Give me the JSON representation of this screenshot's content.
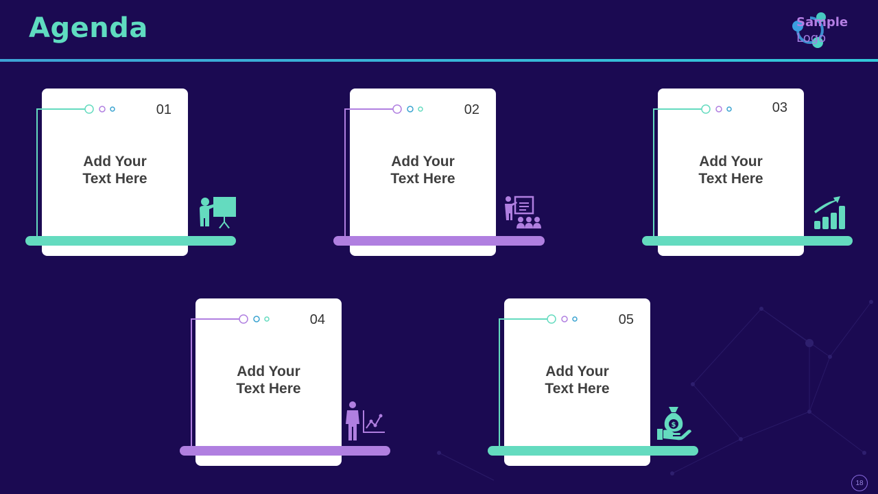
{
  "title": "Agenda",
  "logo": {
    "line1": "Sample",
    "line2": "Logo"
  },
  "page_number": "18",
  "colors": {
    "background": "#1b0a52",
    "teal": "#64dbbf",
    "purple": "#b07fe0",
    "divider": "#33b5d9"
  },
  "items": [
    {
      "number": "01",
      "line1": "Add Your",
      "line2": "Text Here",
      "accent": "teal",
      "icon": "presentation-board-icon"
    },
    {
      "number": "02",
      "line1": "Add Your",
      "line2": "Text Here",
      "accent": "purple",
      "icon": "presenter-audience-icon"
    },
    {
      "number": "03",
      "line1": "Add Your",
      "line2": "Text Here",
      "accent": "teal",
      "icon": "growth-chart-icon"
    },
    {
      "number": "04",
      "line1": "Add Your",
      "line2": "Text Here",
      "accent": "purple",
      "icon": "businessman-chart-icon"
    },
    {
      "number": "05",
      "line1": "Add Your",
      "line2": "Text Here",
      "accent": "teal",
      "icon": "money-bag-hand-icon"
    }
  ]
}
